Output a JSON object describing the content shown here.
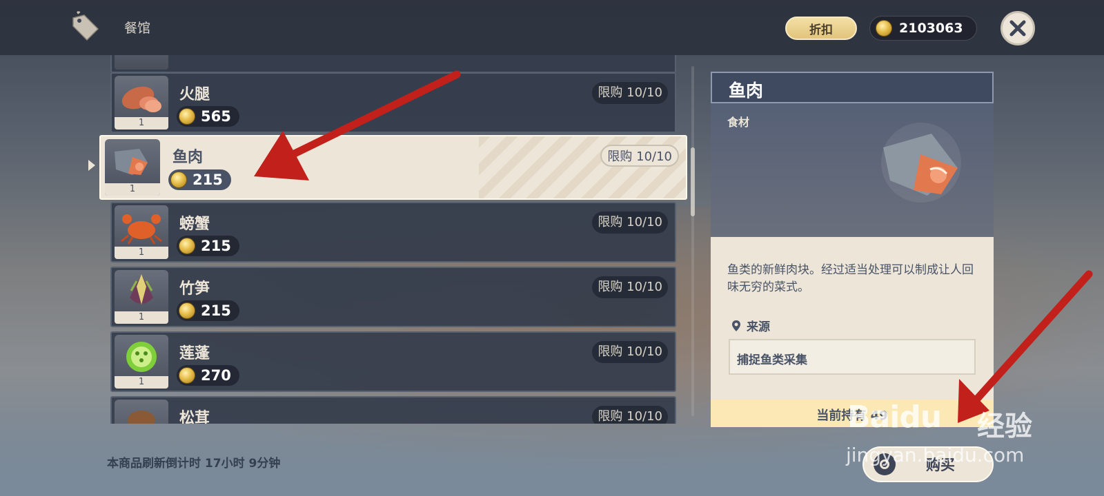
{
  "header": {
    "shop_title": "餐馆",
    "discount_label": "折扣",
    "mora": "2103063"
  },
  "items": [
    {
      "name": "火腿",
      "price": "565",
      "limit": "限购 10/10",
      "qty": "1"
    },
    {
      "name": "鱼肉",
      "price": "215",
      "limit": "限购 10/10",
      "qty": "1",
      "selected": true
    },
    {
      "name": "螃蟹",
      "price": "215",
      "limit": "限购 10/10",
      "qty": "1"
    },
    {
      "name": "竹笋",
      "price": "215",
      "limit": "限购 10/10",
      "qty": "1"
    },
    {
      "name": "莲蓬",
      "price": "270",
      "limit": "限购 10/10",
      "qty": "1"
    },
    {
      "name": "松茸",
      "price": "",
      "limit": "限购 10/10",
      "qty": ""
    }
  ],
  "refresh_text": "本商品刷新倒计时 17小时 9分钟",
  "detail": {
    "title": "鱼肉",
    "category": "食材",
    "description": "鱼类的新鲜肉块。经过适当处理可以制成让人回味无穷的菜式。",
    "source_label": "来源",
    "source_value": "捕捉鱼类采集",
    "held": "当前持有 49"
  },
  "buy_label": "购买",
  "watermark": {
    "logo": "Baidu",
    "cn": "经验",
    "url": "jingyan.baidu.com"
  },
  "colors": {
    "panel_light": "#ece5d8",
    "panel_dark": "#3f4a60",
    "annotation_arrow": "#c2201a"
  }
}
